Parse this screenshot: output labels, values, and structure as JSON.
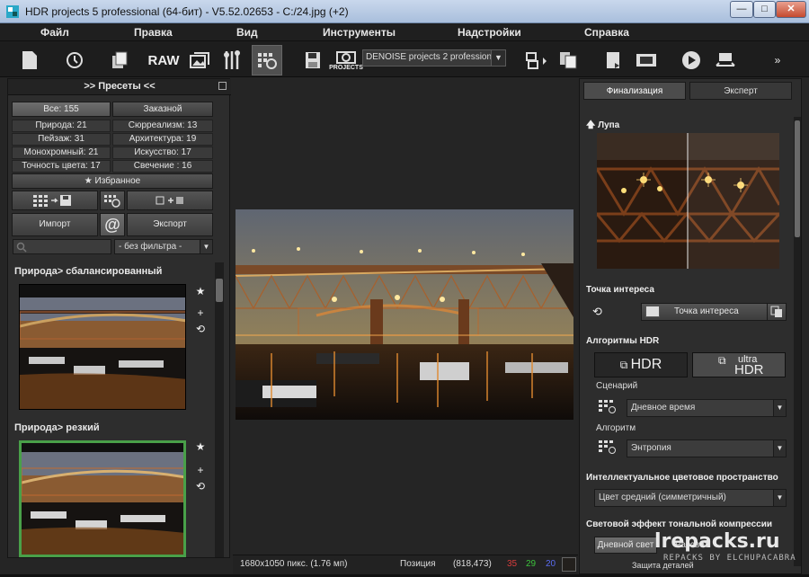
{
  "window": {
    "title": "HDR projects 5 professional (64-бит) - V5.52.02653 - C:/24.jpg (+2)",
    "buttons": {
      "minimize": "—",
      "maximize": "□",
      "close": "✕"
    }
  },
  "menu": [
    "Файл",
    "Правка",
    "Вид",
    "Инструменты",
    "Надстройки",
    "Справка"
  ],
  "toolbar": {
    "raw_label": "RAW",
    "projects_label": "PROJECTS",
    "denoise_value": "DENOISE projects 2 professional",
    "more": "»"
  },
  "presets_panel": {
    "title": ">> Пресеты <<",
    "tabs": {
      "all": "Все: 155",
      "custom": "Заказной"
    },
    "categories": [
      [
        "Природа: 21",
        "Сюрреализм: 13"
      ],
      [
        "Пейзаж: 31",
        "Архитектура: 19"
      ],
      [
        "Монохромный: 21",
        "Искусство: 17"
      ],
      [
        "Точность цвета: 17",
        "Свечение   : 16"
      ]
    ],
    "favorites": "Избранное",
    "import": "Импорт",
    "at": "@",
    "export": "Экспорт",
    "filter": "- без фильтра -",
    "presets": [
      {
        "label": "Природа> сбалансированный"
      },
      {
        "label": "Природа> резкий"
      }
    ]
  },
  "status": {
    "size": "1680x1050 пикс. (1.76 мп)",
    "position_label": "Позиция",
    "position": "(818,473)",
    "r": "35",
    "g": "29",
    "b": "20"
  },
  "right_panel": {
    "tabs": {
      "final": "Финализация",
      "expert": "Эксперт"
    },
    "loupe": "Лупа",
    "interest": {
      "title": "Точка интереса",
      "button": "Точка интереса"
    },
    "algorithms": {
      "title": "Алгоритмы HDR",
      "hdr": "HDR",
      "ultra_top": "ultra",
      "ultra_bottom": "HDR",
      "scenario_label": "Сценарий",
      "scenario_value": "Дневное время",
      "algorithm_label": "Алгоритм",
      "algorithm_value": "Энтропия"
    },
    "color_space": {
      "title": "Интеллектуальное цветовое пространство",
      "value": "Цвет средний (симметричный)"
    },
    "tone": {
      "title": "Световой эффект тональной компрессии",
      "daylight": "Дневной свет",
      "night": "Рассвет",
      "detail": "Защита деталей"
    }
  },
  "watermark": {
    "line1": "lrepacks.ru",
    "line2": "REPACKS BY ELCHUPACABRA"
  },
  "colors": {
    "status_r": "#d83c3c",
    "status_g": "#3cc23c",
    "status_b": "#5a6cf0",
    "selected_border": "#49a049"
  }
}
